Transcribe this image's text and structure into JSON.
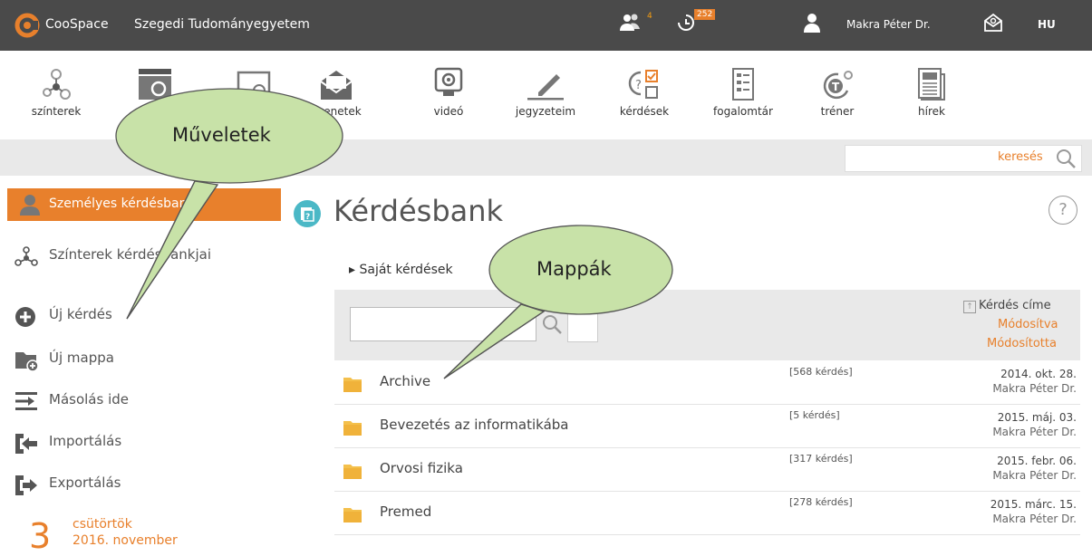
{
  "topbar": {
    "brand": "CooSpace",
    "institution": "Szegedi Tudományegyetem",
    "people_count": "4",
    "notifications_count": "252",
    "user_name": "Makra Péter Dr.",
    "language": "HU",
    "background": "#4a4a4a",
    "accent": "#e8802c"
  },
  "toolbar": {
    "items": [
      {
        "label": "színterek",
        "icon": "scenes-icon"
      },
      {
        "label": "",
        "icon": "folder-history-icon"
      },
      {
        "label": "",
        "icon": "calendar-icon"
      },
      {
        "label": "üzenetek",
        "icon": "envelope-icon"
      },
      {
        "label": "videó",
        "icon": "webcam-icon"
      },
      {
        "label": "jegyzeteim",
        "icon": "pencil-icon"
      },
      {
        "label": "kérdések",
        "icon": "questions-icon"
      },
      {
        "label": "fogalomtár",
        "icon": "glossary-icon"
      },
      {
        "label": "tréner",
        "icon": "trainer-icon"
      },
      {
        "label": "hírek",
        "icon": "news-icon"
      }
    ]
  },
  "search": {
    "label": "keresés"
  },
  "sidebar": {
    "active": "Személyes kérdésbank",
    "items": [
      "Színterek kérdésbankjai",
      "Új kérdés",
      "Új mappa",
      "Másolás ide",
      "Importálás",
      "Exportálás"
    ],
    "date_day": "3",
    "date_weekday": "csütörtök",
    "date_month": "2016. november"
  },
  "main": {
    "title": "Kérdésbank",
    "help": "?",
    "breadcrumb": "▸ Saját kérdések",
    "sort": {
      "title": "Kérdés címe",
      "modified": "Módosítva",
      "modified_by": "Módosította"
    },
    "folders": [
      {
        "name": "Archive",
        "count": "[568 kérdés]",
        "date": "2014. okt. 28.",
        "by": "Makra Péter Dr."
      },
      {
        "name": "Bevezetés az informatikába",
        "count": "[5 kérdés]",
        "date": "2015. máj. 03.",
        "by": "Makra Péter Dr."
      },
      {
        "name": "Orvosi fizika",
        "count": "[317 kérdés]",
        "date": "2015. febr. 06.",
        "by": "Makra Péter Dr."
      },
      {
        "name": "Premed",
        "count": "[278 kérdés]",
        "date": "2015. márc. 15.",
        "by": "Makra Péter Dr."
      }
    ]
  },
  "callouts": {
    "operations": "Műveletek",
    "folders": "Mappák",
    "fill": "#c8e2a8"
  }
}
